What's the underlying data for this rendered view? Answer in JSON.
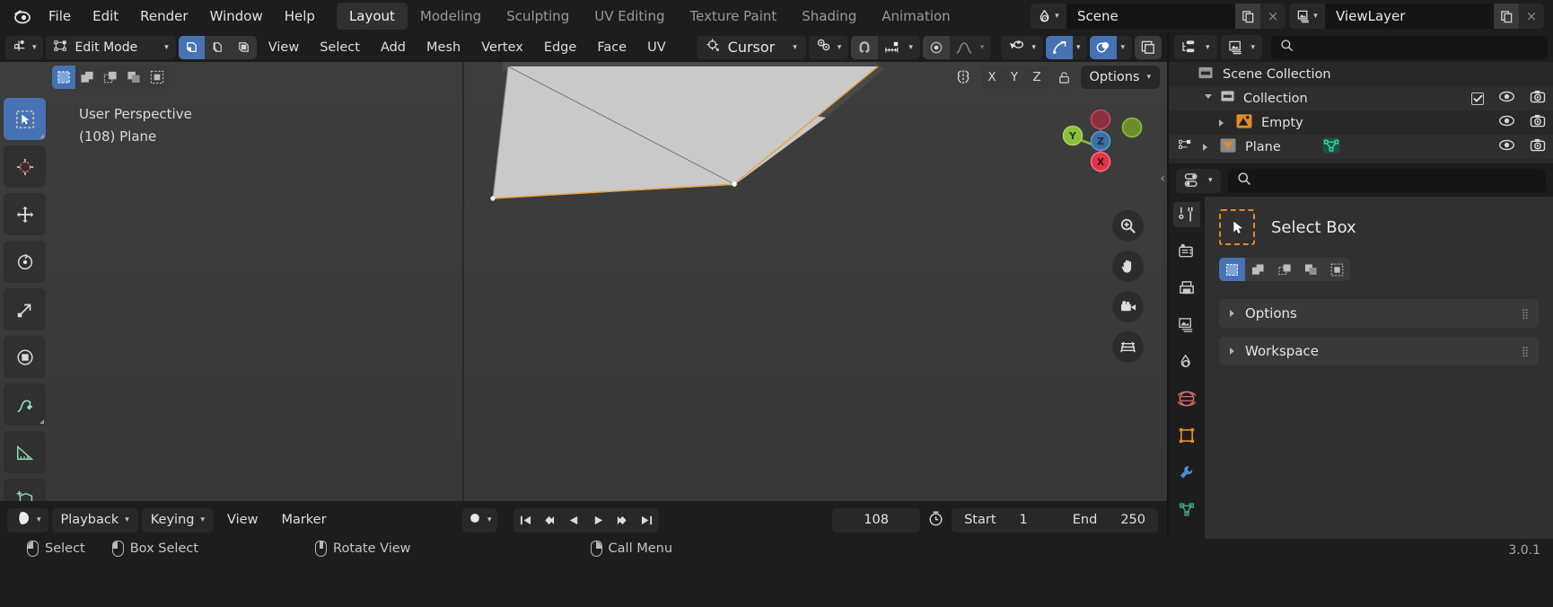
{
  "topbar": {
    "logo_icon": "blender-logo-icon",
    "menus": [
      "File",
      "Edit",
      "Render",
      "Window",
      "Help"
    ],
    "workspaces": [
      {
        "label": "Layout",
        "active": true
      },
      {
        "label": "Modeling",
        "active": false
      },
      {
        "label": "Sculpting",
        "active": false
      },
      {
        "label": "UV Editing",
        "active": false
      },
      {
        "label": "Texture Paint",
        "active": false
      },
      {
        "label": "Shading",
        "active": false
      },
      {
        "label": "Animation",
        "active": false
      }
    ],
    "scene": {
      "icon": "scene-icon",
      "name": "Scene",
      "copy_icon": "new-copy-icon",
      "close_label": "×"
    },
    "viewlayer": {
      "icon": "view-layer-icon",
      "name": "ViewLayer",
      "copy_icon": "new-copy-icon",
      "close_label": "×"
    }
  },
  "tool_header": {
    "editor_type_icon": "editor-type-3dview-icon",
    "mode": "Edit Mode",
    "mesh_select_modes": [
      "vertex-select-icon",
      "edge-select-icon",
      "face-select-icon"
    ],
    "menus": [
      "View",
      "Select",
      "Add",
      "Mesh",
      "Vertex",
      "Edge",
      "Face",
      "UV"
    ],
    "transform_pivot": {
      "icon": "cursor-icon",
      "label": "Cursor"
    },
    "snap_icon": "snap-magnet-icon",
    "proportional_icon": "proportional-edit-icon",
    "proportional_falloff_icon": "falloff-curve-icon",
    "visibility_icon": "object-visibility-icon",
    "gizmo_icon": "gizmo-icon",
    "overlays_icon": "overlays-icon",
    "xray_icon": "xray-toggle-icon",
    "shading_icons": [
      "shading-solid-icon"
    ]
  },
  "viewport": {
    "select_modes": [
      {
        "icon": "select-box-icon",
        "active": true
      },
      {
        "icon": "select-extend-icon",
        "active": false
      },
      {
        "icon": "select-subtract-icon",
        "active": false
      },
      {
        "icon": "select-invert-icon",
        "active": false
      },
      {
        "icon": "select-intersect-icon",
        "active": false
      }
    ],
    "mirror_icon": "mirror-x-icon",
    "axis_buttons": [
      "X",
      "Y",
      "Z"
    ],
    "lock_icon": "lock-icon",
    "options_label": "Options",
    "info_line1": "User Perspective",
    "info_line2": "(108) Plane",
    "gizmo_axes": [
      {
        "label": "Z",
        "color": "#3b72b0"
      },
      {
        "label": "Y",
        "color": "#8bbf3d"
      },
      {
        "label": "X",
        "color": "#e04a5f"
      }
    ],
    "nav_buttons": [
      "zoom-icon",
      "pan-hand-icon",
      "camera-view-icon",
      "toggle-ortho-icon"
    ],
    "toolbar_tools": [
      {
        "icon": "tweak-select-box-icon",
        "active": true
      },
      {
        "icon": "cursor-3d-icon",
        "active": false
      },
      {
        "icon": "move-icon",
        "active": false
      },
      {
        "icon": "rotate-icon",
        "active": false
      },
      {
        "icon": "scale-icon",
        "active": false
      },
      {
        "icon": "transform-icon",
        "active": false
      },
      {
        "icon": "annotate-icon",
        "active": false
      },
      {
        "icon": "measure-icon",
        "active": false
      },
      {
        "icon": "add-cube-icon",
        "active": false
      }
    ]
  },
  "timeline": {
    "editor_icon": "timeline-editor-icon",
    "playback_label": "Playback",
    "keying_label": "Keying",
    "view_label": "View",
    "marker_label": "Marker",
    "record_icon": "auto-keying-icon",
    "transport": [
      "jump-start-icon",
      "prev-keyframe-icon",
      "play-reverse-icon",
      "play-icon",
      "next-keyframe-icon",
      "jump-end-icon"
    ],
    "current_frame": "108",
    "start_label": "Start",
    "start_value": "1",
    "end_label": "End",
    "end_value": "250"
  },
  "statusbar": {
    "items": [
      {
        "icon": "mouse-left-icon",
        "label": "Select"
      },
      {
        "icon": "mouse-left-drag-icon",
        "label": "Box Select"
      },
      {
        "icon": "mouse-middle-icon",
        "label": "Rotate View"
      },
      {
        "icon": "mouse-right-icon",
        "label": "Call Menu"
      }
    ],
    "version": "3.0.1"
  },
  "outliner": {
    "display_mode_icon": "outliner-display-mode-icon",
    "filter_icon": "outliner-filter-icon",
    "search_icon": "search-icon",
    "rows": [
      {
        "name": "Scene Collection",
        "icon": "scene-collection-icon",
        "indent": 0,
        "expander": "none",
        "checkbox": false,
        "eye": false,
        "camera": false,
        "alt": false
      },
      {
        "name": "Collection",
        "icon": "collection-icon",
        "indent": 1,
        "expander": "down",
        "checkbox": true,
        "eye": true,
        "camera": true,
        "alt": true
      },
      {
        "name": "Empty",
        "icon": "image-empty-icon",
        "indent": 2,
        "expander": "right",
        "checkbox": false,
        "eye": true,
        "camera": true,
        "alt": false
      },
      {
        "name": "Plane",
        "icon": "mesh-object-icon",
        "indent": 2,
        "expander": "right",
        "checkbox": false,
        "eye": true,
        "camera": true,
        "alt": true,
        "data_icon": "mesh-data-icon"
      }
    ]
  },
  "properties": {
    "editor_icon": "properties-editor-icon",
    "search_icon": "search-icon",
    "tabs": [
      {
        "icon": "tool-tab-icon",
        "active": true,
        "color": "#d0d0d0"
      },
      {
        "icon": "render-tab-icon",
        "active": false,
        "color": "#c8c8c8"
      },
      {
        "icon": "output-tab-icon",
        "active": false,
        "color": "#c8c8c8"
      },
      {
        "icon": "view-layer-tab-icon",
        "active": false,
        "color": "#c8c8c8"
      },
      {
        "icon": "scene-tab-icon",
        "active": false,
        "color": "#c8c8c8"
      },
      {
        "icon": "world-tab-icon",
        "active": false,
        "color": "#d36a6a"
      },
      {
        "icon": "object-tab-icon",
        "active": false,
        "color": "#e08c2b"
      },
      {
        "icon": "modifier-tab-icon",
        "active": false,
        "color": "#4a8ed6"
      },
      {
        "icon": "data-tab-icon",
        "active": false,
        "color": "#3fa07c"
      }
    ],
    "active_tool_name": "Select Box",
    "active_tool_icon": "select-box-tool-icon",
    "mode_segments": [
      {
        "icon": "set-select-icon",
        "active": true
      },
      {
        "icon": "extend-select-icon",
        "active": false
      },
      {
        "icon": "subtract-select-icon",
        "active": false
      },
      {
        "icon": "difference-select-icon",
        "active": false
      },
      {
        "icon": "intersect-select-icon",
        "active": false
      }
    ],
    "panels": [
      {
        "label": "Options",
        "expanded": false
      },
      {
        "label": "Workspace",
        "expanded": false
      }
    ]
  }
}
